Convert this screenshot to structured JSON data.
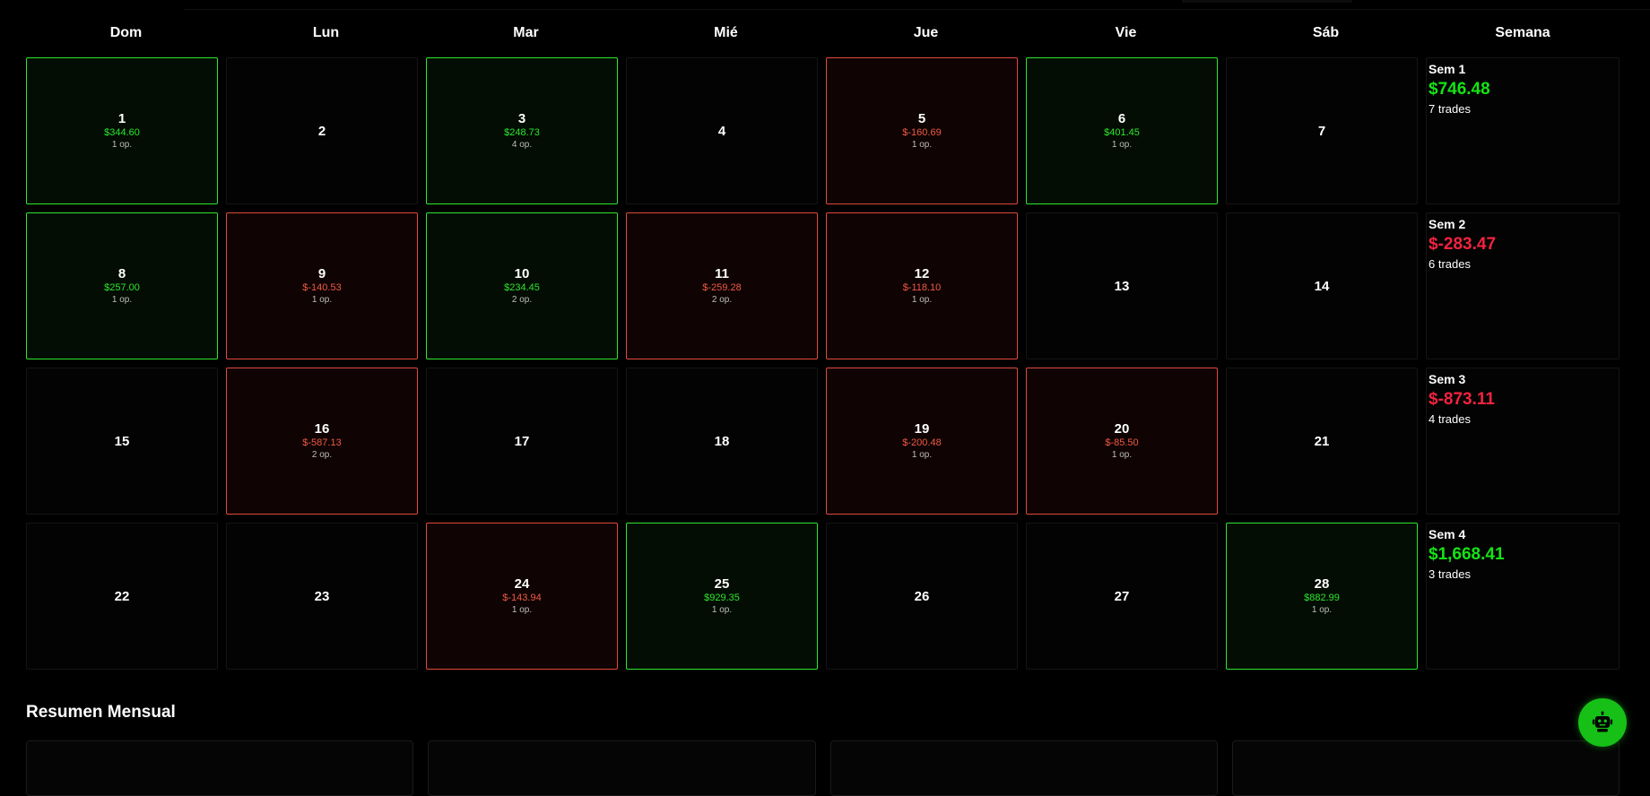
{
  "headers": [
    "Dom",
    "Lun",
    "Mar",
    "Mié",
    "Jue",
    "Vie",
    "Sáb",
    "Semana"
  ],
  "weeks": [
    {
      "label": "Sem 1",
      "total": "$746.48",
      "trades": "7 trades",
      "status": "pos",
      "days": [
        {
          "num": "1",
          "pnl": "$344.60",
          "ops": "1 op.",
          "status": "pos"
        },
        {
          "num": "2",
          "pnl": "",
          "ops": "",
          "status": "none"
        },
        {
          "num": "3",
          "pnl": "$248.73",
          "ops": "4 op.",
          "status": "pos"
        },
        {
          "num": "4",
          "pnl": "",
          "ops": "",
          "status": "none"
        },
        {
          "num": "5",
          "pnl": "$-160.69",
          "ops": "1 op.",
          "status": "neg"
        },
        {
          "num": "6",
          "pnl": "$401.45",
          "ops": "1 op.",
          "status": "pos"
        },
        {
          "num": "7",
          "pnl": "",
          "ops": "",
          "status": "none"
        }
      ]
    },
    {
      "label": "Sem 2",
      "total": "$-283.47",
      "trades": "6 trades",
      "status": "neg",
      "days": [
        {
          "num": "8",
          "pnl": "$257.00",
          "ops": "1 op.",
          "status": "pos"
        },
        {
          "num": "9",
          "pnl": "$-140.53",
          "ops": "1 op.",
          "status": "neg"
        },
        {
          "num": "10",
          "pnl": "$234.45",
          "ops": "2 op.",
          "status": "pos"
        },
        {
          "num": "11",
          "pnl": "$-259.28",
          "ops": "2 op.",
          "status": "neg"
        },
        {
          "num": "12",
          "pnl": "$-118.10",
          "ops": "1 op.",
          "status": "neg"
        },
        {
          "num": "13",
          "pnl": "",
          "ops": "",
          "status": "none"
        },
        {
          "num": "14",
          "pnl": "",
          "ops": "",
          "status": "none"
        }
      ]
    },
    {
      "label": "Sem 3",
      "total": "$-873.11",
      "trades": "4 trades",
      "status": "neg",
      "days": [
        {
          "num": "15",
          "pnl": "",
          "ops": "",
          "status": "none"
        },
        {
          "num": "16",
          "pnl": "$-587.13",
          "ops": "2 op.",
          "status": "neg"
        },
        {
          "num": "17",
          "pnl": "",
          "ops": "",
          "status": "none"
        },
        {
          "num": "18",
          "pnl": "",
          "ops": "",
          "status": "none"
        },
        {
          "num": "19",
          "pnl": "$-200.48",
          "ops": "1 op.",
          "status": "neg"
        },
        {
          "num": "20",
          "pnl": "$-85.50",
          "ops": "1 op.",
          "status": "neg"
        },
        {
          "num": "21",
          "pnl": "",
          "ops": "",
          "status": "none"
        }
      ]
    },
    {
      "label": "Sem 4",
      "total": "$1,668.41",
      "trades": "3 trades",
      "status": "pos",
      "days": [
        {
          "num": "22",
          "pnl": "",
          "ops": "",
          "status": "none"
        },
        {
          "num": "23",
          "pnl": "",
          "ops": "",
          "status": "none"
        },
        {
          "num": "24",
          "pnl": "$-143.94",
          "ops": "1 op.",
          "status": "neg"
        },
        {
          "num": "25",
          "pnl": "$929.35",
          "ops": "1 op.",
          "status": "pos"
        },
        {
          "num": "26",
          "pnl": "",
          "ops": "",
          "status": "none"
        },
        {
          "num": "27",
          "pnl": "",
          "ops": "",
          "status": "none"
        },
        {
          "num": "28",
          "pnl": "$882.99",
          "ops": "1 op.",
          "status": "pos"
        }
      ]
    }
  ],
  "summary": {
    "title": "Resumen Mensual"
  },
  "fab": {
    "icon": "robot-icon"
  },
  "colors": {
    "positive": "#2ee62e",
    "negative": "#f25a45",
    "fab": "#16c016"
  }
}
